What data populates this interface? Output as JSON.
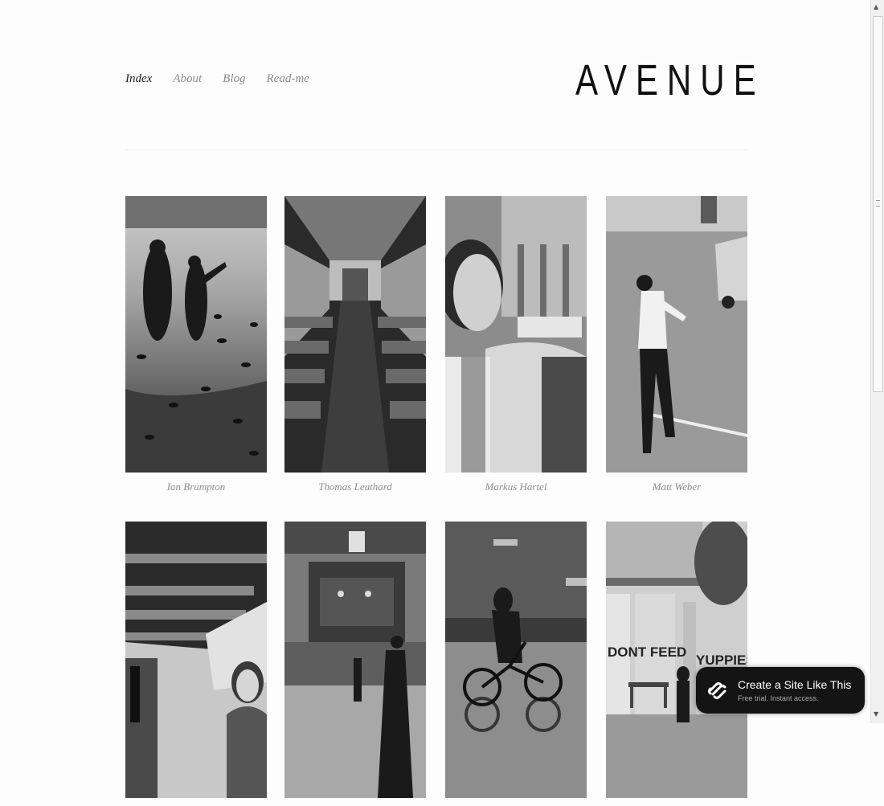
{
  "nav": {
    "items": [
      {
        "label": "Index",
        "active": true
      },
      {
        "label": "About",
        "active": false
      },
      {
        "label": "Blog",
        "active": false
      },
      {
        "label": "Read-me",
        "active": false
      }
    ]
  },
  "site": {
    "title": "AVENUE"
  },
  "gallery": {
    "items": [
      {
        "caption": "Ian Brumpton"
      },
      {
        "caption": "Thomas Leuthard"
      },
      {
        "caption": "Markus Hartel"
      },
      {
        "caption": "Matt Weber"
      },
      {
        "caption": ""
      },
      {
        "caption": ""
      },
      {
        "caption": ""
      },
      {
        "caption": ""
      }
    ]
  },
  "photo_text": {
    "graffiti_1": "DONT FEED",
    "graffiti_2": "YUPPIES"
  },
  "cta": {
    "title": "Create a Site Like This",
    "subtitle": "Free trial. Instant access.",
    "icon": "squarespace-logo-icon"
  },
  "colors": {
    "background": "#fdfdfd",
    "active_nav": "#222222",
    "muted_text": "#8c8c8c",
    "cta_bg": "#141414"
  }
}
